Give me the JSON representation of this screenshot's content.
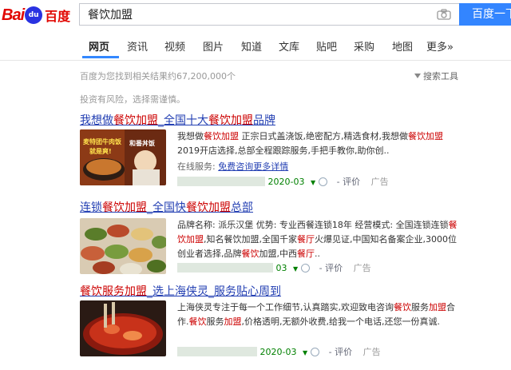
{
  "header": {
    "logo_latin": "Bai",
    "logo_paw": "du",
    "logo_cn": "百度",
    "search_value": "餐饮加盟",
    "search_button": "百度一下"
  },
  "tabs": [
    {
      "label": "网页",
      "active": true
    },
    {
      "label": "资讯"
    },
    {
      "label": "视频"
    },
    {
      "label": "图片"
    },
    {
      "label": "知道"
    },
    {
      "label": "文库"
    },
    {
      "label": "贴吧"
    },
    {
      "label": "采购"
    },
    {
      "label": "地图"
    },
    {
      "label": "更多»"
    }
  ],
  "stats": "百度为您找到相关结果约67,200,000个",
  "tools_label": "搜索工具",
  "risk_notice": "投资有风险，选择需谨慎。",
  "results": [
    {
      "title_parts": [
        "我想做",
        "餐饮加盟",
        "_全国十大",
        "餐饮加盟",
        "品牌"
      ],
      "text_parts": [
        "我想做",
        "餐饮加盟",
        " 正宗日式盖浇饭,绝密配方,精选食材,我想做",
        "餐饮加盟",
        " 2019开店选择,总部全程跟踪服务,手把手教你,助你创.."
      ],
      "online_label": "在线服务:",
      "online_link": "免费咨询更多详情",
      "date": "2020-03",
      "eval": "评价",
      "ad": "广告",
      "thumb_caption_1": "麦特团牛肉饭",
      "thumb_caption_2": "就是爽!",
      "thumb_caption_3": "和番丼饭"
    },
    {
      "title_parts": [
        "连锁",
        "餐饮加盟",
        "_全国快",
        "餐饮加盟",
        "总部"
      ],
      "text_parts": [
        "品牌名称: 派乐汉堡    优势: 专业西餐连锁18年    经营模式: 全国连锁连锁",
        "餐饮加盟",
        ",知名餐饮加盟,全国千家",
        "餐厅",
        "火爆见证,中国知名备案企业,3000位创业者选择,品牌",
        "餐饮",
        "加盟,中西",
        "餐厅",
        ".."
      ],
      "date": "03",
      "eval": "评价",
      "ad": "广告"
    },
    {
      "title_parts": [
        "餐饮服务",
        "加盟",
        "_选上海侠灵_服务贴心周到"
      ],
      "text_parts": [
        "上海侠灵专注于每一个工作细节,认真踏实,欢迎致电咨询",
        "餐饮",
        "服务",
        "加盟",
        "合作.",
        "餐饮",
        "服务",
        "加盟",
        ",价格透明,无额外收费,给我一个电话,还您一份真诚."
      ],
      "date": "2020-03",
      "eval": "评价",
      "ad": "广告"
    }
  ],
  "colors": {
    "link": "#2440b3",
    "highlight": "#cc0000",
    "brand_red": "#e10601",
    "brand_blue": "#2932e1",
    "button": "#3385ff"
  }
}
